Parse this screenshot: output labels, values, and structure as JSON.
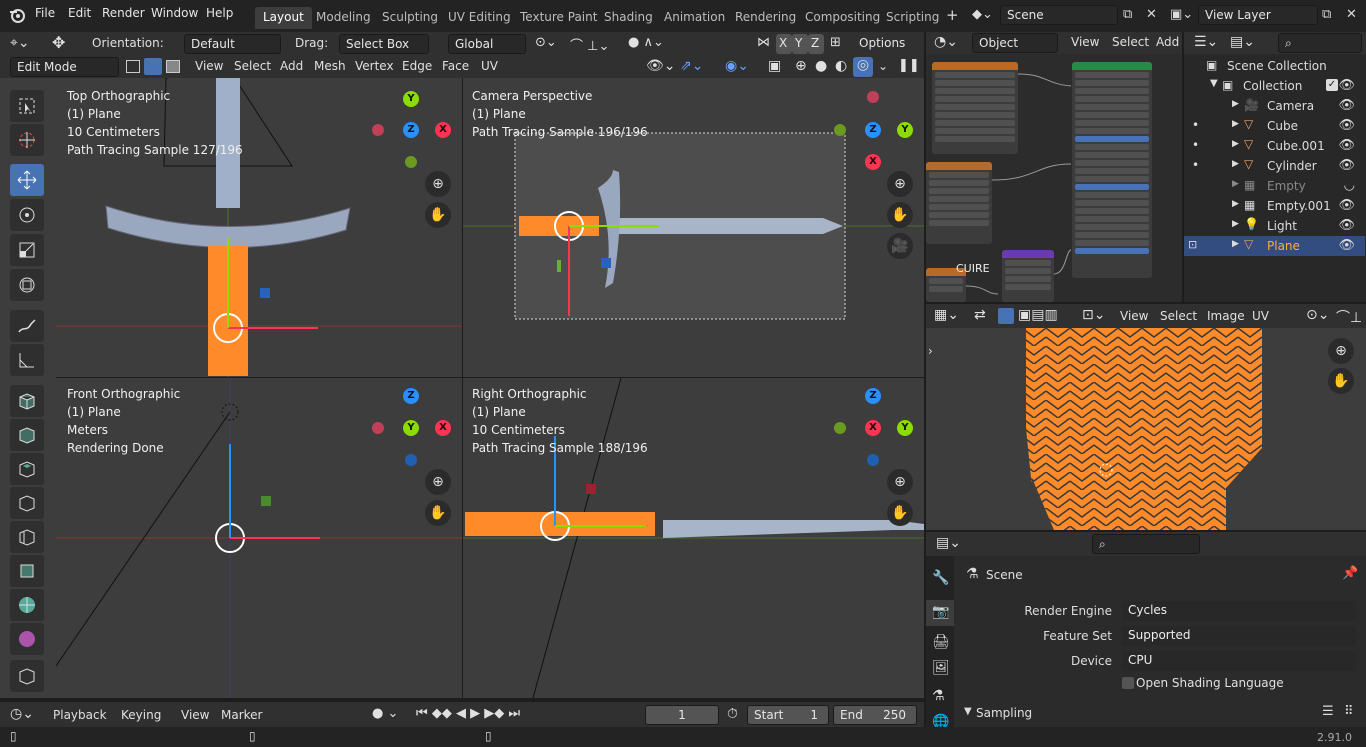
{
  "menu": {
    "file": "File",
    "edit": "Edit",
    "render": "Render",
    "window": "Window",
    "help": "Help"
  },
  "workspaces": [
    "Layout",
    "Modeling",
    "Sculpting",
    "UV Editing",
    "Texture Paint",
    "Shading",
    "Animation",
    "Rendering",
    "Compositing",
    "Scripting"
  ],
  "scene": "Scene",
  "view_layer": "View Layer",
  "tool_header": {
    "orientation_label": "Orientation:",
    "orientation": "Default",
    "drag_label": "Drag:",
    "drag": "Select Box",
    "transform": "Global",
    "options": "Options"
  },
  "mode_header": {
    "mode": "Edit Mode",
    "view": "View",
    "select": "Select",
    "add": "Add",
    "mesh": "Mesh",
    "vertex": "Vertex",
    "edge": "Edge",
    "face": "Face",
    "uv": "UV"
  },
  "viewports": [
    {
      "title": "Top Orthographic",
      "obj": "(1) Plane",
      "scale": "10 Centimeters",
      "status": "Path Tracing Sample 127/196"
    },
    {
      "title": "Camera Perspective",
      "obj": "(1) Plane",
      "status": "Path Tracing Sample 196/196"
    },
    {
      "title": "Front Orthographic",
      "obj": "(1) Plane",
      "scale": "Meters",
      "status": "Rendering Done"
    },
    {
      "title": "Right Orthographic",
      "obj": "(1) Plane",
      "scale": "10 Centimeters",
      "status": "Path Tracing Sample 188/196"
    }
  ],
  "node_editor": {
    "mode": "Object",
    "view": "View",
    "select": "Select",
    "add": "Add",
    "label": "CUIRE"
  },
  "outliner": {
    "root": "Scene Collection",
    "collection": "Collection",
    "items": [
      "Camera",
      "Cube",
      "Cube.001",
      "Cylinder",
      "Empty",
      "Empty.001",
      "Light",
      "Plane"
    ]
  },
  "image_editor": {
    "view": "View",
    "select": "Select",
    "image": "Image",
    "uv": "UV"
  },
  "properties": {
    "scene": "Scene",
    "render_engine_label": "Render Engine",
    "render_engine": "Cycles",
    "feature_set_label": "Feature Set",
    "feature_set": "Supported",
    "device_label": "Device",
    "device": "CPU",
    "osl": "Open Shading Language",
    "sampling": "Sampling"
  },
  "timeline": {
    "playback": "Playback",
    "keying": "Keying",
    "view": "View",
    "marker": "Marker",
    "frame": "1",
    "start_label": "Start",
    "start": "1",
    "end_label": "End",
    "end": "250"
  },
  "version": "2.91.0",
  "colors": {
    "accent": "#4772b3",
    "orange": "#ff8a2a",
    "x_axis": "#ff3352",
    "y_axis": "#8bdc00",
    "z_axis": "#2890ff"
  }
}
